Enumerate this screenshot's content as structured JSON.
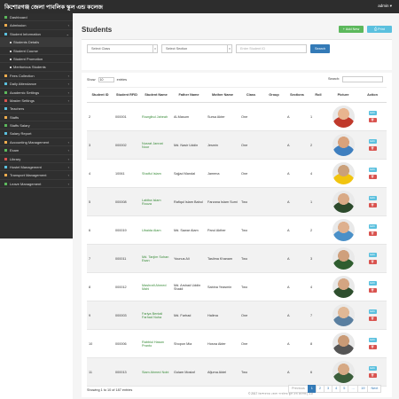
{
  "header": {
    "brand": "কিশোরগঞ্জ জেলা পাবলিক স্কুল এন্ড কলেজ",
    "user": "admin ▾"
  },
  "sidebar": {
    "items": [
      {
        "label": "Dashboard",
        "caret": "",
        "sub": false,
        "icon_color": "#5cb85c"
      },
      {
        "label": "Admission",
        "caret": "‹",
        "sub": false,
        "icon_color": "#f0ad4e"
      },
      {
        "label": "Student Information",
        "caret": "⌄",
        "sub": false,
        "icon_color": "#5bc0de"
      },
      {
        "label": "Students Details",
        "caret": "",
        "sub": true,
        "icon_color": "#ccc"
      },
      {
        "label": "Student Course",
        "caret": "",
        "sub": true,
        "icon_color": "#ccc"
      },
      {
        "label": "Student Promotion",
        "caret": "",
        "sub": true,
        "icon_color": "#ccc"
      },
      {
        "label": "Meritorious Students",
        "caret": "",
        "sub": true,
        "icon_color": "#ccc"
      },
      {
        "label": "Fees Collection",
        "caret": "‹",
        "sub": false,
        "icon_color": "#f0ad4e"
      },
      {
        "label": "Daily Attendance",
        "caret": "‹",
        "sub": false,
        "icon_color": "#5bc0de"
      },
      {
        "label": "Academic Settings",
        "caret": "‹",
        "sub": false,
        "icon_color": "#5cb85c"
      },
      {
        "label": "Master Settings",
        "caret": "‹",
        "sub": false,
        "icon_color": "#d9534f"
      },
      {
        "label": "Teachers",
        "caret": "",
        "sub": false,
        "icon_color": "#5bc0de"
      },
      {
        "label": "Staffs",
        "caret": "",
        "sub": false,
        "icon_color": "#f0ad4e"
      },
      {
        "label": "Staffs Salary",
        "caret": "",
        "sub": false,
        "icon_color": "#5cb85c"
      },
      {
        "label": "Salary Report",
        "caret": "",
        "sub": false,
        "icon_color": "#5bc0de"
      },
      {
        "label": "Accounting Management",
        "caret": "‹",
        "sub": false,
        "icon_color": "#f0ad4e"
      },
      {
        "label": "Exam",
        "caret": "‹",
        "sub": false,
        "icon_color": "#5cb85c"
      },
      {
        "label": "Library",
        "caret": "‹",
        "sub": false,
        "icon_color": "#d9534f"
      },
      {
        "label": "Hostel Management",
        "caret": "‹",
        "sub": false,
        "icon_color": "#5bc0de"
      },
      {
        "label": "Transport Management",
        "caret": "‹",
        "sub": false,
        "icon_color": "#f0ad4e"
      },
      {
        "label": "Leave Management",
        "caret": "‹",
        "sub": false,
        "icon_color": "#5cb85c"
      }
    ]
  },
  "main": {
    "title": "Students",
    "add_label": "+ Add New",
    "print_label": "⎙ Print",
    "filters": {
      "class_placeholder": "Select Class",
      "section_placeholder": "Select Section",
      "id_placeholder": "Enter Student ID",
      "search_label": "Search"
    },
    "table": {
      "show_label": "Show",
      "show_value": "10",
      "entries_label": "entries",
      "search_label": "Search:",
      "columns": [
        "Student ID",
        "Student RFID",
        "Student Name",
        "Father Name",
        "Mother Name",
        "Class",
        "Group",
        "Sections",
        "Roll",
        "Picture",
        "Action"
      ],
      "rows": [
        {
          "id": "2",
          "rfid": "000001",
          "name": "Rowgibul Jaheah",
          "father": "Al-Masum",
          "mother": "Sursa Akter",
          "class": "One",
          "group": "",
          "section": "A",
          "roll": "1",
          "pic_bg": "#c0392b",
          "pic_face": "#e8b58f"
        },
        {
          "id": "3",
          "rfid": "000002",
          "name": "Nusrat Jannat Noor",
          "father": "Md. Nasir Uddin",
          "mother": "Jesmin",
          "class": "One",
          "group": "",
          "section": "A",
          "roll": "2",
          "pic_bg": "#3f7fbf",
          "pic_face": "#d8a27c"
        },
        {
          "id": "4",
          "rfid": "10061",
          "name": "Shaiful Islam",
          "father": "Sajjad Mandal",
          "mother": "Jamena",
          "class": "One",
          "group": "",
          "section": "A",
          "roll": "4",
          "pic_bg": "#f1c40f",
          "pic_face": "#caa07a"
        },
        {
          "id": "5",
          "rfid": "000008",
          "name": "Labiba Islam Rouza",
          "father": "Rafiqul Islam Babul",
          "mother": "Farzana Islam Sumi",
          "class": "Two",
          "group": "",
          "section": "A",
          "roll": "1",
          "pic_bg": "#2c4a2c",
          "pic_face": "#d9aa86"
        },
        {
          "id": "6",
          "rfid": "000019",
          "name": "Ubaida Alam",
          "father": "Md. Sawar Alam",
          "mother": "Parul Akther",
          "class": "Two",
          "group": "",
          "section": "A",
          "roll": "2",
          "pic_bg": "#4a90c8",
          "pic_face": "#deb08e"
        },
        {
          "id": "7",
          "rfid": "000011",
          "name": "Md. Tanjim Sohan Esan",
          "father": "Younus Ali",
          "mother": "Taslima Khanam",
          "class": "Two",
          "group": "",
          "section": "A",
          "roll": "3",
          "pic_bg": "#2f5d2f",
          "pic_face": "#cfa07c"
        },
        {
          "id": "8",
          "rfid": "000012",
          "name": "Mashrafi Ahmed Mahi",
          "father": "Md. Arshad Uddin Shakil",
          "mother": "Sabina Yeasmin",
          "class": "Two",
          "group": "",
          "section": "A",
          "roll": "4",
          "pic_bg": "#2e4f2e",
          "pic_face": "#d4a582"
        },
        {
          "id": "9",
          "rfid": "000003",
          "name": "Fariya Bentali Farhad Nuha",
          "father": "Md. Farhad",
          "mother": "Halima",
          "class": "One",
          "group": "",
          "section": "A",
          "roll": "7",
          "pic_bg": "#5a7fa0",
          "pic_face": "#e0b896"
        },
        {
          "id": "10",
          "rfid": "000006",
          "name": "Rabbiul Hasan Pranto",
          "father": "Shopon Mia",
          "mother": "Hosna Akter",
          "class": "One",
          "group": "",
          "section": "A",
          "roll": "8",
          "pic_bg": "#555555",
          "pic_face": "#c99a76"
        },
        {
          "id": "11",
          "rfid": "000013",
          "name": "Siam Ahmed Nobi",
          "father": "Golam Mostaf",
          "mother": "Afjuma Aktel",
          "class": "Two",
          "group": "",
          "section": "A",
          "roll": "6",
          "pic_bg": "#3b5e3b",
          "pic_face": "#d6a985"
        }
      ],
      "edit_label": "Edit",
      "delete_label": "🗑",
      "showing": "Showing 1 to 10 of 187 entries",
      "pagination": [
        "Previous",
        "1",
        "2",
        "3",
        "4",
        "5",
        "…",
        "19",
        "Next"
      ]
    }
  },
  "footer": {
    "text": "© 2017 কিশোরগঞ্জ জেলা পাবলিক স্কুল এন্ড কলেজ | 1.0"
  }
}
